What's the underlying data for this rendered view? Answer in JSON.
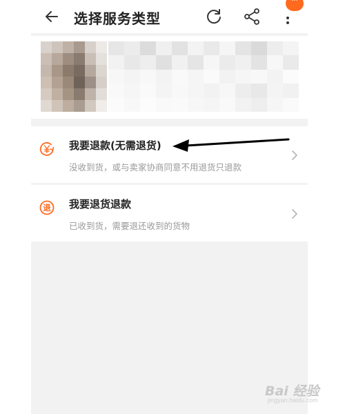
{
  "header": {
    "title": "选择服务类型",
    "back_icon": "arrow-left-icon",
    "refresh_icon": "refresh-icon",
    "share_icon": "share-icon",
    "more_icon": "more-vertical-icon",
    "more_badge": "···"
  },
  "product": {
    "thumbnail": "blurred-product-image",
    "info": "blurred-product-details"
  },
  "options": [
    {
      "title": "我要退款(无需退货)",
      "desc": "没收到货，或与卖家协商同意不用退货只退款",
      "icon": "refund-yen-icon"
    },
    {
      "title": "我要退货退款",
      "desc": "已收到货，需要退还收到的货物",
      "icon": "return-icon",
      "icon_char": "退"
    }
  ],
  "watermark": {
    "logo": "Bai 经验",
    "url": "jingyan.baidu.com"
  },
  "colors": {
    "accent": "#ff6a1f",
    "background": "#f2f2f2",
    "text": "#222222",
    "secondary_text": "#999999"
  }
}
